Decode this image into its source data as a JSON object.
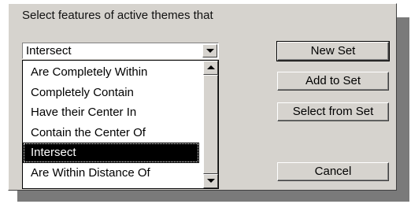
{
  "dialog": {
    "prompt": "Select features of active themes that"
  },
  "combo": {
    "value": "Intersect"
  },
  "list": {
    "items": [
      {
        "label": "Are Completely Within"
      },
      {
        "label": "Completely Contain"
      },
      {
        "label": "Have their Center In"
      },
      {
        "label": "Contain the Center Of"
      },
      {
        "label": "Intersect",
        "selected": true
      },
      {
        "label": "Are Within Distance Of"
      }
    ]
  },
  "buttons": {
    "new_set": "New Set",
    "add_to_set": "Add to Set",
    "select_from_set": "Select from Set",
    "cancel": "Cancel"
  },
  "icons": {
    "dropdown": "chevron-down-icon",
    "scroll_up": "chevron-up-icon",
    "scroll_down": "chevron-down-icon"
  },
  "colors": {
    "dialog_bg": "#d6d3ce",
    "selection_bg": "#000000",
    "selection_fg": "#ffffff"
  }
}
